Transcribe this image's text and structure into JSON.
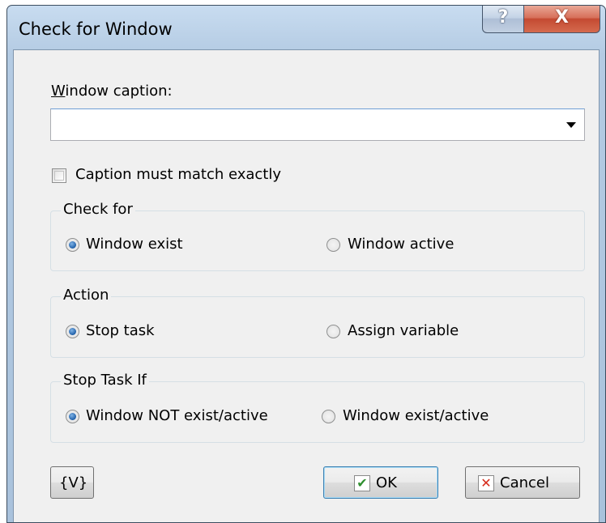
{
  "window": {
    "title": "Check for Window",
    "help_glyph": "?",
    "close_glyph": "X"
  },
  "caption_field": {
    "label_accel": "W",
    "label_rest": "indow caption:",
    "value": "",
    "icon": "chevron-down-icon"
  },
  "exact_match": {
    "label": "Caption must match exactly",
    "checked": false
  },
  "check_for": {
    "title": "Check for",
    "options": [
      {
        "label": "Window exist",
        "selected": true
      },
      {
        "label": "Window active",
        "selected": false
      }
    ]
  },
  "action": {
    "title": "Action",
    "options": [
      {
        "label": "Stop task",
        "selected": true
      },
      {
        "label": "Assign variable",
        "selected": false
      }
    ]
  },
  "stop_task_if": {
    "title": "Stop Task If",
    "options": [
      {
        "label": "Window NOT exist/active",
        "selected": true
      },
      {
        "label": "Window exist/active",
        "selected": false
      }
    ]
  },
  "buttons": {
    "variables": "{V}",
    "ok": "OK",
    "ok_icon": "checkmark-icon",
    "cancel": "Cancel",
    "cancel_icon": "x-icon"
  },
  "colors": {
    "titlebar": "#b4cbe3",
    "client_bg": "#f0f0f0",
    "close_button": "#c44a32",
    "ok_check": "#2f8f2f",
    "cancel_x": "#d62a1a",
    "radio_selected": "#1f5fa8"
  }
}
